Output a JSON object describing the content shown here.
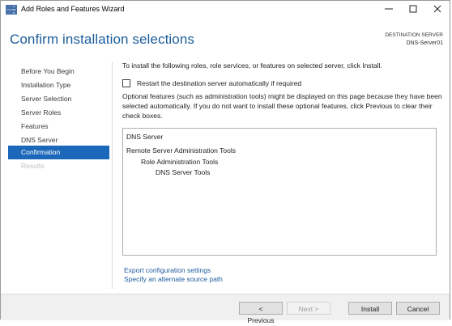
{
  "window": {
    "title": "Add Roles and Features Wizard",
    "controls": {
      "minimize": "—",
      "maximize": "☐",
      "close": "✕"
    }
  },
  "header": {
    "page_title": "Confirm installation selections",
    "destination_label": "DESTINATION SERVER",
    "destination_server": "DNS-Server01"
  },
  "nav": {
    "items": [
      {
        "label": "Before You Begin",
        "state": "normal"
      },
      {
        "label": "Installation Type",
        "state": "normal"
      },
      {
        "label": "Server Selection",
        "state": "normal"
      },
      {
        "label": "Server Roles",
        "state": "normal"
      },
      {
        "label": "Features",
        "state": "normal"
      },
      {
        "label": "DNS Server",
        "state": "normal"
      },
      {
        "label": "Confirmation",
        "state": "active"
      },
      {
        "label": "Results",
        "state": "disabled"
      }
    ]
  },
  "content": {
    "intro": "To install the following roles, role services, or features on selected server, click Install.",
    "restart_label": "Restart the destination server automatically if required",
    "restart_checked": false,
    "note": "Optional features (such as administration tools) might be displayed on this page because they have been selected automatically. If you do not want to install these optional features, click Previous to clear their check boxes.",
    "selections": [
      {
        "text": "DNS Server",
        "level": 0
      },
      {
        "text": "Remote Server Administration Tools",
        "level": 0
      },
      {
        "text": "Role Administration Tools",
        "level": 1
      },
      {
        "text": "DNS Server Tools",
        "level": 2
      }
    ],
    "links": {
      "export": "Export configuration settings",
      "alternate_source": "Specify an alternate source path"
    }
  },
  "footer": {
    "previous": "< Previous",
    "next": "Next >",
    "install": "Install",
    "cancel": "Cancel"
  },
  "colors": {
    "title_blue": "#1a5d9a",
    "nav_active": "#1b67b9",
    "link_blue": "#1e5c9e"
  }
}
